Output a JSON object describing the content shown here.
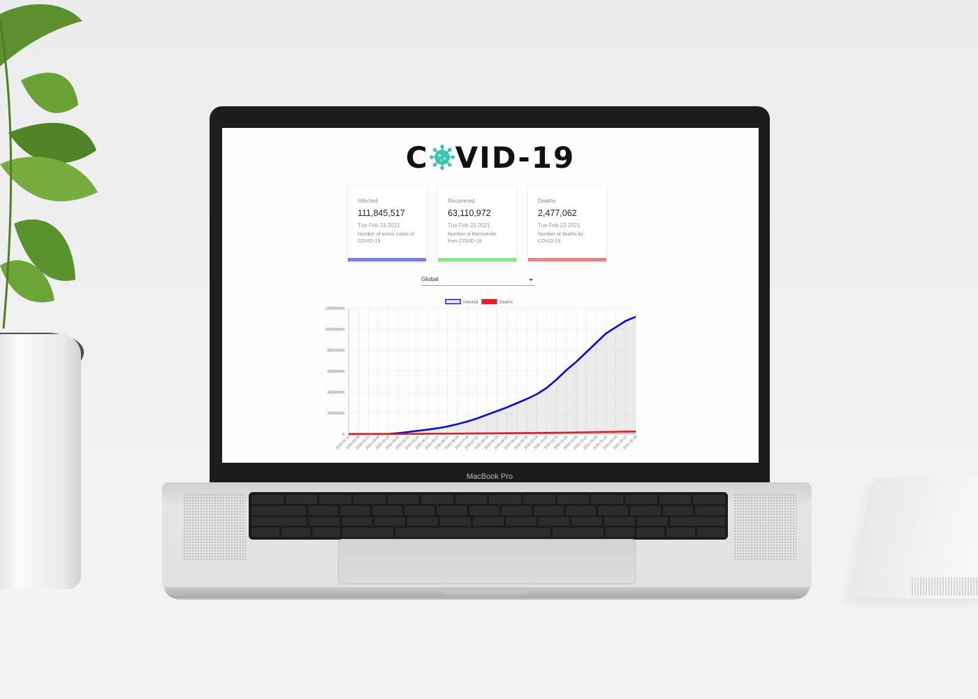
{
  "logo": {
    "left": "C",
    "right": "VID-19"
  },
  "cards": [
    {
      "title": "Infected",
      "value": "111,845,517",
      "date": "Tue Feb 23 2021",
      "desc": "Number of active cases of COVID-19",
      "color": "#7b7bf5"
    },
    {
      "title": "Recovered",
      "value": "63,110,972",
      "date": "Tue Feb 23 2021",
      "desc": "Number of Recoveries from COVID-19",
      "color": "#7ff07f"
    },
    {
      "title": "Deaths",
      "value": "2,477,062",
      "date": "Tue Feb 23 2021",
      "desc": "Number of deaths by COVID-19",
      "color": "#f07f7f"
    }
  ],
  "country_select": {
    "value": "Global"
  },
  "laptop": {
    "brand_label": "MacBook Pro"
  },
  "chart_data": {
    "type": "line",
    "legend": [
      "Infected",
      "Deaths"
    ],
    "legend_position": "top",
    "grid": true,
    "ylim": [
      0,
      120000000
    ],
    "yticks": [
      "0",
      "20000000",
      "40000000",
      "60000000",
      "80000000",
      "100000000",
      "120000000"
    ],
    "x": [
      "2020-01-22",
      "2020-02-05",
      "2020-02-19",
      "2020-03-04",
      "2020-03-18",
      "2020-04-01",
      "2020-04-15",
      "2020-04-29",
      "2020-05-13",
      "2020-05-27",
      "2020-06-10",
      "2020-06-24",
      "2020-07-08",
      "2020-07-22",
      "2020-08-05",
      "2020-08-19",
      "2020-09-02",
      "2020-09-16",
      "2020-09-30",
      "2020-10-14",
      "2020-10-28",
      "2020-11-11",
      "2020-11-25",
      "2020-12-09",
      "2020-12-23",
      "2021-01-06",
      "2021-01-20",
      "2021-02-03",
      "2021-02-17",
      "2021-02-23"
    ],
    "series": [
      {
        "name": "Infected",
        "color": "#0b0bd0",
        "values": [
          500,
          40000,
          75000,
          95000,
          220000,
          900000,
          2000000,
          3100000,
          4300000,
          5600000,
          7300000,
          9500000,
          12000000,
          15000000,
          18500000,
          22000000,
          25500000,
          29500000,
          33500000,
          38000000,
          44000000,
          52000000,
          61000000,
          69000000,
          78000000,
          87000000,
          96000000,
          102000000,
          108000000,
          111845517
        ]
      },
      {
        "name": "Deaths",
        "color": "#e02020",
        "values": [
          17,
          500,
          2200,
          3200,
          8700,
          47000,
          125000,
          230000,
          295000,
          350000,
          415000,
          490000,
          545000,
          620000,
          700000,
          790000,
          860000,
          935000,
          1010000,
          1090000,
          1180000,
          1285000,
          1420000,
          1570000,
          1720000,
          1900000,
          2070000,
          2240000,
          2400000,
          2477062
        ]
      }
    ]
  }
}
